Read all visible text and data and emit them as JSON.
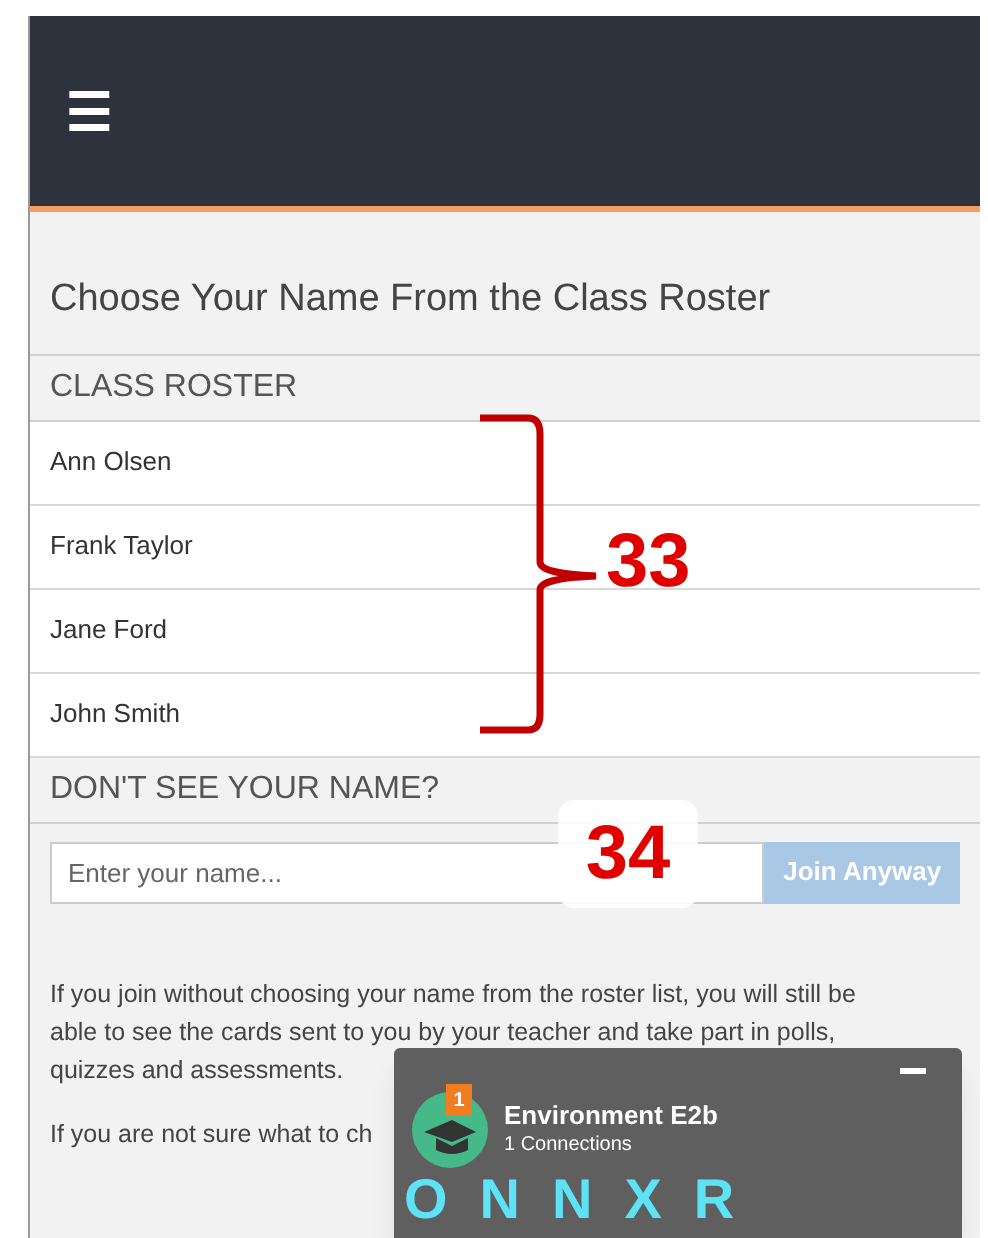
{
  "header": {
    "menu_icon": "☰"
  },
  "title": "Choose Your Name From the Class Roster",
  "roster": {
    "heading": "CLASS ROSTER",
    "students": [
      {
        "name": "Ann Olsen"
      },
      {
        "name": "Frank Taylor"
      },
      {
        "name": "Jane Ford"
      },
      {
        "name": "John Smith"
      }
    ]
  },
  "join": {
    "heading": "DON'T SEE YOUR NAME?",
    "placeholder": "Enter your name...",
    "button": {
      "label": "Join Anyway",
      "disabled": true
    }
  },
  "paragraphs": [
    "If you join without choosing your name from the roster list, you will still be able to see the cards sent to you by your teacher and take part in polls, quizzes and assessments.",
    "If you are not sure what to ch"
  ],
  "callouts": [
    {
      "label": "33"
    },
    {
      "label": "34"
    }
  ],
  "panel": {
    "badge": "1",
    "title": "Environment E2b",
    "subtitle": "1 Connections",
    "code": "ONNXR"
  }
}
